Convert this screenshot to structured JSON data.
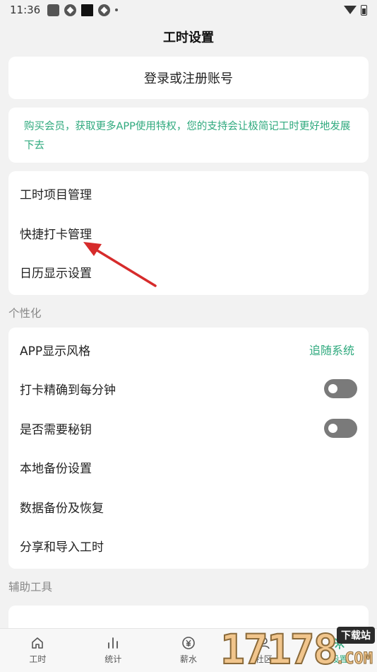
{
  "status_bar": {
    "time": "11:36"
  },
  "header": {
    "title": "工时设置"
  },
  "login": {
    "label": "登录或注册账号"
  },
  "vip": {
    "text": "购买会员，获取更多APP使用特权，您的支持会让极简记工时更好地发展下去"
  },
  "menu": {
    "items": [
      {
        "label": "工时项目管理"
      },
      {
        "label": "快捷打卡管理"
      },
      {
        "label": "日历显示设置"
      }
    ]
  },
  "personalization": {
    "section_title": "个性化",
    "app_style": {
      "label": "APP显示风格",
      "value": "追随系统"
    },
    "precise_punch": {
      "label": "打卡精确到每分钟",
      "enabled": false
    },
    "require_password": {
      "label": "是否需要秘钥",
      "enabled": false
    },
    "local_backup": {
      "label": "本地备份设置"
    },
    "backup_restore": {
      "label": "数据备份及恢复"
    },
    "share_import": {
      "label": "分享和导入工时"
    }
  },
  "tools": {
    "section_title": "辅助工具"
  },
  "bottom_nav": {
    "items": [
      {
        "label": "工时",
        "icon": "home-icon"
      },
      {
        "label": "统计",
        "icon": "bar-chart-icon"
      },
      {
        "label": "薪水",
        "icon": "yen-coin-icon"
      },
      {
        "label": "社区",
        "icon": "person-icon"
      },
      {
        "label": "设置",
        "icon": "gear-icon"
      }
    ]
  },
  "watermark": {
    "digits": "17178",
    "badge": "下载站",
    "domain": ".COM"
  },
  "colors": {
    "accent": "#2ea97d",
    "arrow": "#d62b2b",
    "background": "#f2f2f2"
  }
}
